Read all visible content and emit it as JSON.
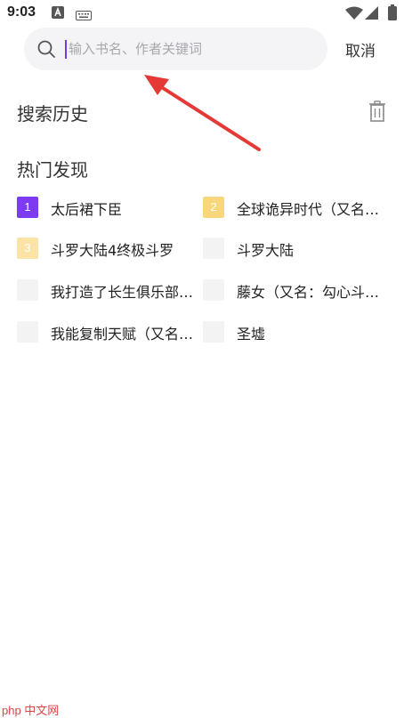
{
  "status_bar": {
    "time": "9:03"
  },
  "search": {
    "placeholder": "输入书名、作者关键词",
    "value": "",
    "cancel_label": "取消"
  },
  "history": {
    "title": "搜索历史"
  },
  "hot": {
    "title": "热门发现",
    "items": [
      {
        "rank": "1",
        "label": "太后裙下臣",
        "rank_color": "#7c3bf2"
      },
      {
        "rank": "2",
        "label": "全球诡异时代（又名…",
        "rank_color": "#f8d77c"
      },
      {
        "rank": "3",
        "label": "斗罗大陆4终极斗罗",
        "rank_color": "#fbe3a6"
      },
      {
        "rank": "",
        "label": "斗罗大陆",
        "rank_color": "#f3f3f4"
      },
      {
        "rank": "",
        "label": "我打造了长生俱乐部…",
        "rank_color": "#f3f3f4"
      },
      {
        "rank": "",
        "label": "藤女（又名：勾心斗…",
        "rank_color": "#f3f3f4"
      },
      {
        "rank": "",
        "label": "我能复制天赋（又名…",
        "rank_color": "#f3f3f4"
      },
      {
        "rank": "",
        "label": "圣墟",
        "rank_color": "#f3f3f4"
      }
    ]
  },
  "watermark": {
    "text": "php 中文网"
  }
}
